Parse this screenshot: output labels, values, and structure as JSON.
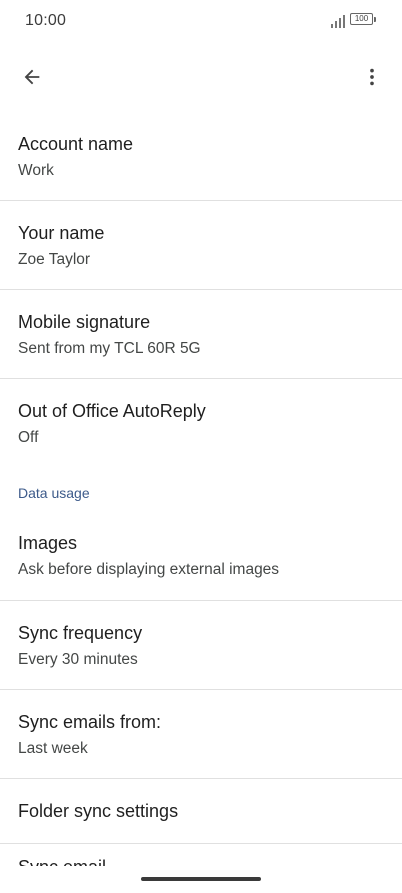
{
  "status_bar": {
    "time": "10:00",
    "battery": "100",
    "icons": [
      "signal-icon",
      "battery-icon"
    ]
  },
  "app_bar": {
    "icons": [
      "back-arrow-icon",
      "more-vert-icon"
    ]
  },
  "settings": {
    "account_name": {
      "title": "Account name",
      "value": "Work"
    },
    "your_name": {
      "title": "Your name",
      "value": "Zoe Taylor"
    },
    "mobile_signature": {
      "title": "Mobile signature",
      "value": "Sent from my TCL 60R 5G"
    },
    "out_of_office": {
      "title": "Out of Office AutoReply",
      "value": "Off"
    },
    "data_usage_header": "Data usage",
    "images": {
      "title": "Images",
      "value": "Ask before displaying external images"
    },
    "sync_frequency": {
      "title": "Sync frequency",
      "value": "Every 30 minutes"
    },
    "sync_emails_from": {
      "title": "Sync emails from:",
      "value": "Last week"
    },
    "folder_sync": {
      "title": "Folder sync settings"
    },
    "sync_email_partial": {
      "title": "Sync email"
    }
  },
  "colors": {
    "section_header": "#3c5a8a",
    "divider": "#e0e0e0",
    "primary_text": "#1f1f1f",
    "secondary_text": "#444746"
  }
}
